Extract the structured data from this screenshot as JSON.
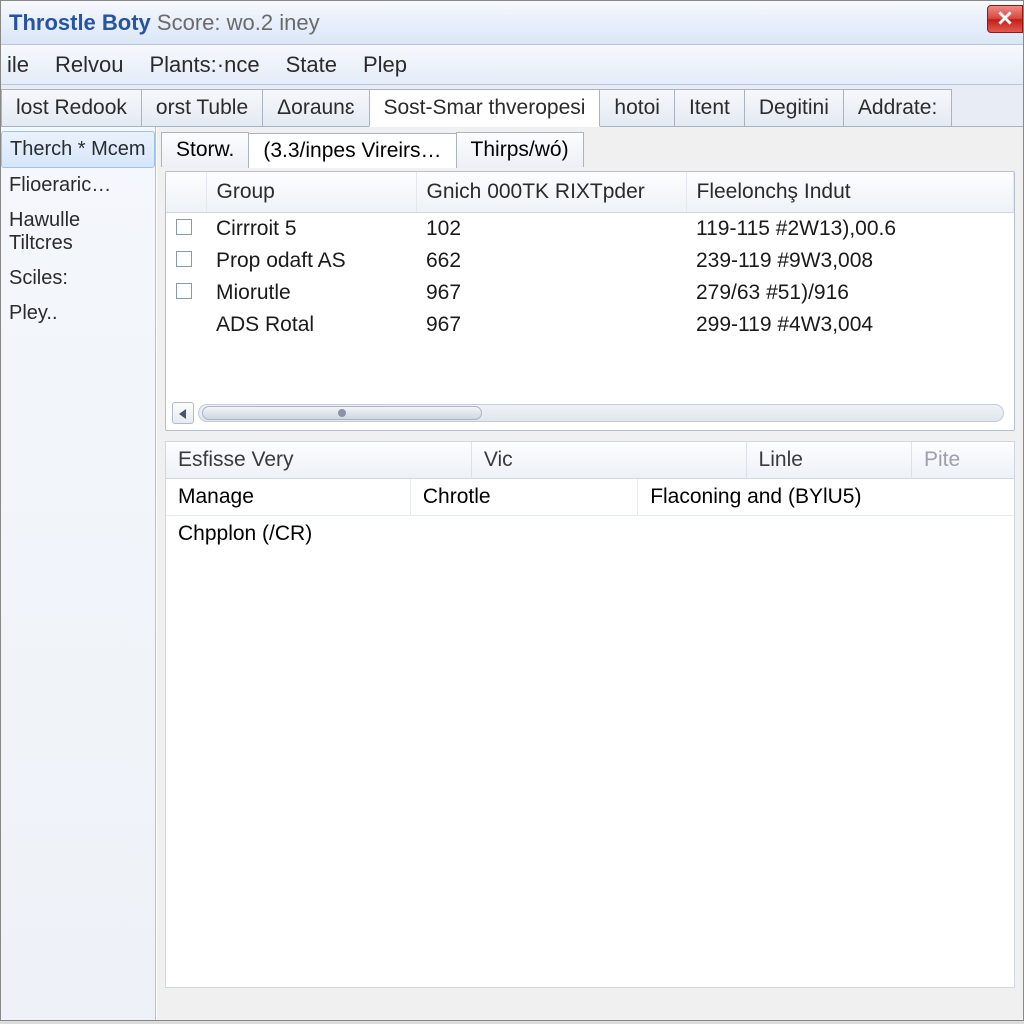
{
  "titlebar": {
    "app": "Throstle Boty",
    "subtitle": "Score:",
    "suffix": "wo.2 iney"
  },
  "menubar": [
    "ile",
    "Relvou",
    "Plants:·nce",
    "State",
    "Plep"
  ],
  "tabs": [
    "lost Redook",
    "orst Tuble",
    "Δoraunɛ",
    "Sost-Smar thveropesi",
    "hotoi",
    "Itent",
    "Degitini",
    "Addrate:"
  ],
  "active_tab_index": 3,
  "sidebar": {
    "items": [
      "Therch * Mcem",
      "Flioeraric…",
      "Hawulle Tiltcres",
      "Sciles:",
      "Pley.."
    ]
  },
  "subtabs": [
    "Storw.",
    "(3.3/inpes Vireirs…",
    "Thirps/wó)"
  ],
  "active_subtab_index": 1,
  "table": {
    "columns": [
      "Group",
      "Gnich 000TK RIXTpder",
      "Fleelonchş Indut"
    ],
    "rows": [
      {
        "check": true,
        "group": "Cirrroit 5",
        "col2": "102",
        "col3": "119-115 #2W13),00.6"
      },
      {
        "check": true,
        "group": "Prop odaft AS",
        "col2": "662",
        "col3": "239-119 #9W3,008"
      },
      {
        "check": true,
        "group": "Miorutle",
        "col2": "967",
        "col3": "279/63 #51)/916"
      },
      {
        "check": false,
        "group": "ADS Rotal",
        "col2": "967",
        "col3": "299-119 #4W3,004"
      }
    ]
  },
  "lower": {
    "headers": [
      "Esfisse Very",
      "Vic",
      "Linle",
      "Pite"
    ],
    "row": {
      "c1": "Manage",
      "c2": "Chrotle",
      "c3": "Flaconing and (BYlU5)"
    },
    "detail": "Chpplon (/CR)"
  }
}
